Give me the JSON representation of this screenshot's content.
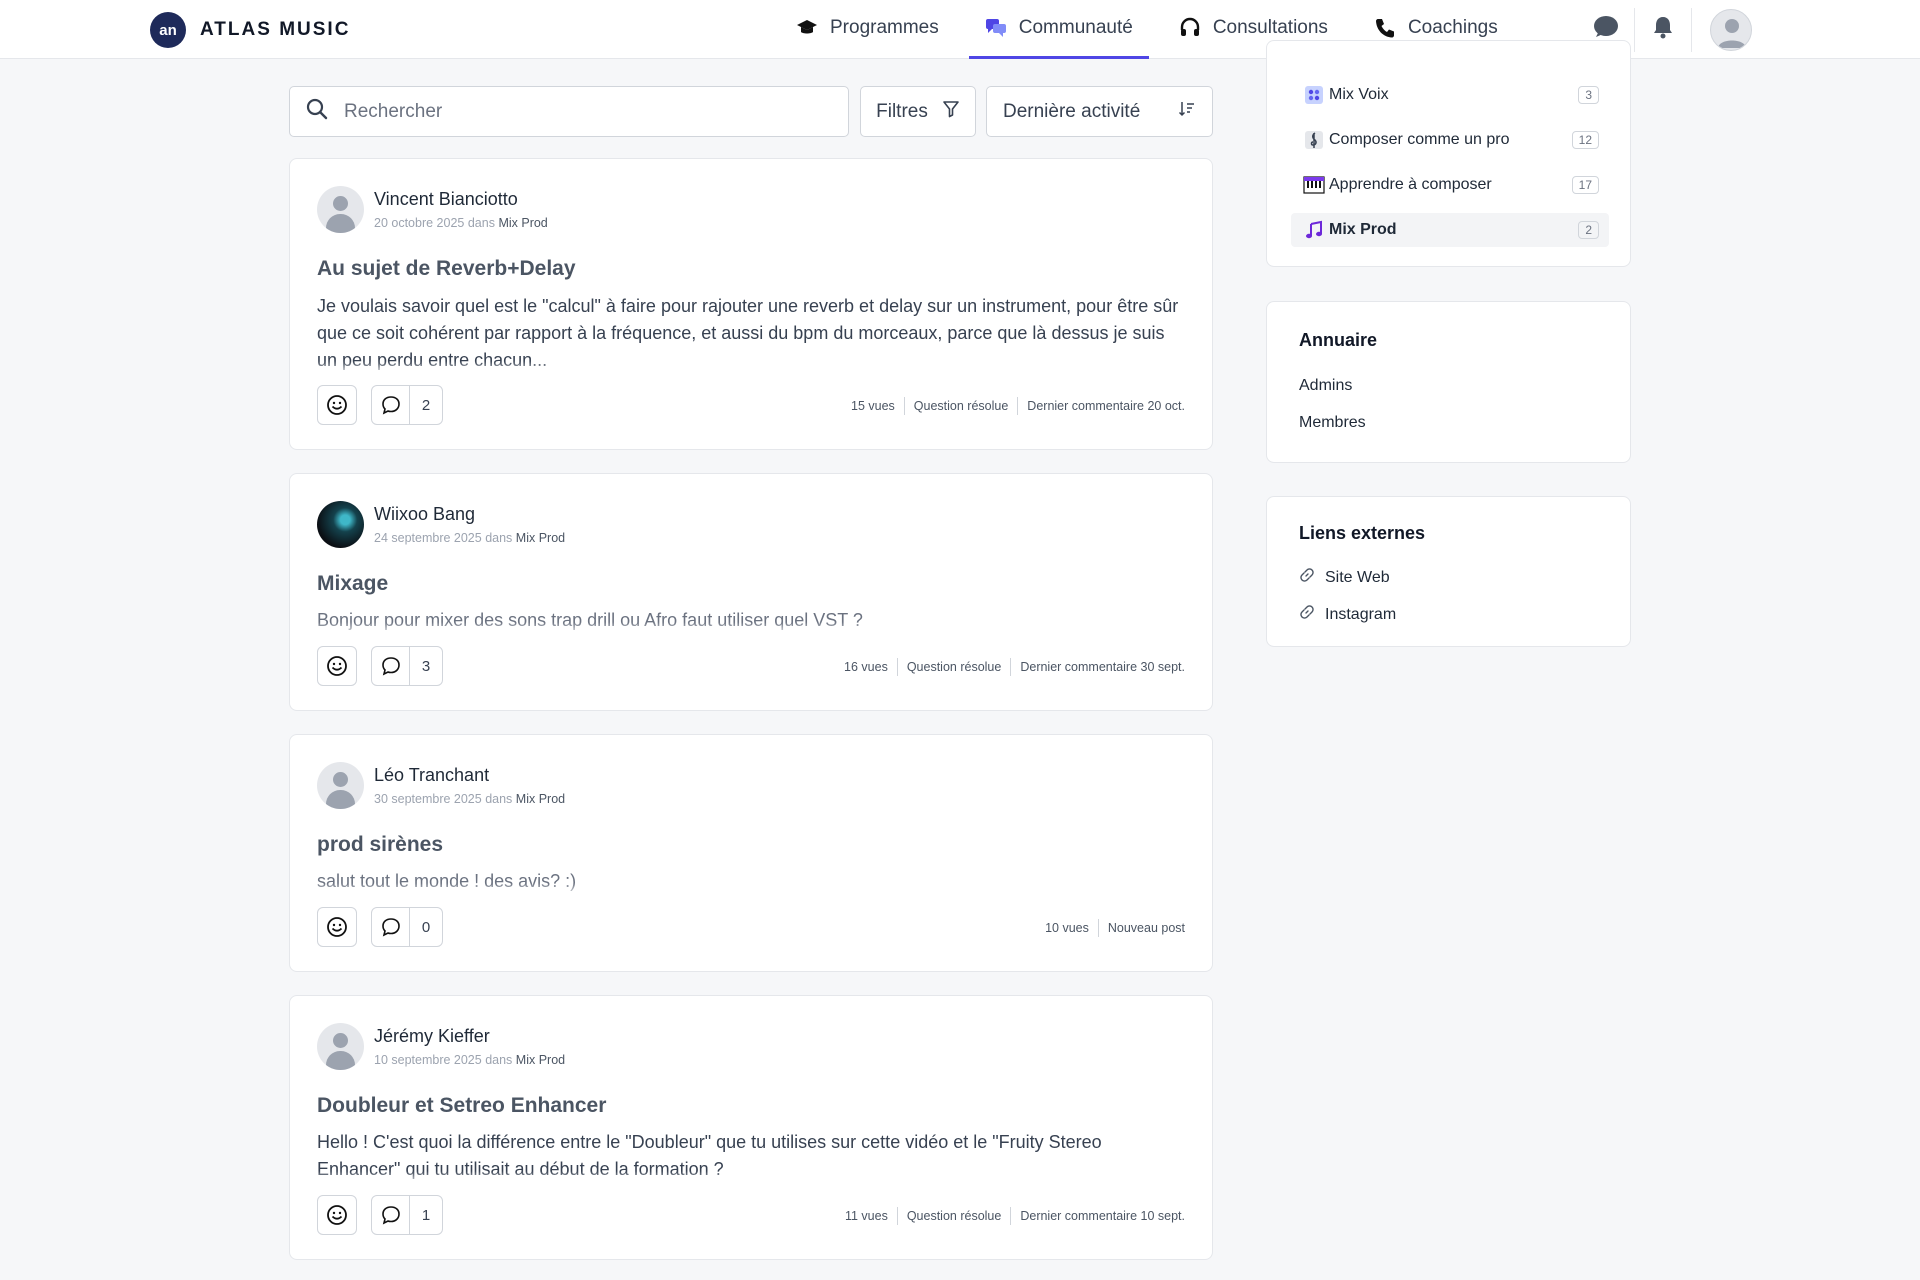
{
  "brand": {
    "logo_mark": "an",
    "name": "ATLAS MUSIC"
  },
  "nav": [
    {
      "label": "Programmes",
      "icon": "graduation-cap-icon"
    },
    {
      "label": "Communauté",
      "icon": "chat-bubbles-icon",
      "active": true
    },
    {
      "label": "Consultations",
      "icon": "headset-icon"
    },
    {
      "label": "Coachings",
      "icon": "phone-icon"
    }
  ],
  "toolbar": {
    "search_placeholder": "Rechercher",
    "filter_label": "Filtres",
    "sort_label": "Dernière activité"
  },
  "posts": [
    {
      "author": "Vincent Bianciotto",
      "date": "20 octobre 2025",
      "in_word": "dans",
      "category": "Mix Prod",
      "title": "Au sujet de Reverb+Delay",
      "body": "Je voulais savoir quel est le \"calcul\" à faire pour rajouter une reverb et delay sur un instrument, pour être sûr que ce soit cohérent par rapport à la fréquence, et aussi du bpm du morceaux, parce que là dessus je suis un peu perdu entre chacun...",
      "comments": "2",
      "views": "15 vues",
      "status": "Question résolue",
      "last_comment": "Dernier commentaire 20 oct."
    },
    {
      "author": "Wiixoo Bang",
      "date": "24 septembre 2025",
      "in_word": "dans",
      "category": "Mix Prod",
      "title": "Mixage",
      "body": "Bonjour pour mixer des sons trap drill ou Afro faut utiliser quel VST ?",
      "comments": "3",
      "views": "16 vues",
      "status": "Question résolue",
      "last_comment": "Dernier commentaire 30 sept."
    },
    {
      "author": "Léo Tranchant",
      "date": "30 septembre 2025",
      "in_word": "dans",
      "category": "Mix Prod",
      "title": "prod sirènes",
      "body": "salut tout le monde ! des avis? :)",
      "comments": "0",
      "views": "10 vues",
      "status": "Nouveau post"
    },
    {
      "author": "Jérémy Kieffer",
      "date": "10 septembre 2025",
      "in_word": "dans",
      "category": "Mix Prod",
      "title": "Doubleur et Setreo Enhancer",
      "body": "Hello ! C'est quoi la différence entre le \"Doubleur\" que tu utilises sur cette vidéo et le \"Fruity Stereo Enhancer\" qui tu utilisait au début de la formation ?",
      "comments": "1",
      "views": "11 vues",
      "status": "Question résolue",
      "last_comment": "Dernier commentaire 10 sept."
    }
  ],
  "categories": [
    {
      "label": "Mix Voix",
      "count": "3",
      "icon": "mixer-icon"
    },
    {
      "label": "Composer comme un pro",
      "count": "12",
      "icon": "treble-clef-icon"
    },
    {
      "label": "Apprendre à composer",
      "count": "17",
      "icon": "piano-keys-icon"
    },
    {
      "label": "Mix Prod",
      "count": "2",
      "icon": "music-notes-icon",
      "active": true
    }
  ],
  "directory": {
    "title": "Annuaire",
    "items": [
      "Admins",
      "Membres"
    ]
  },
  "external_links": {
    "title": "Liens externes",
    "items": [
      "Site Web",
      "Instagram"
    ]
  },
  "colors": {
    "accent": "#4f46e5",
    "brand": "#1e2a5a"
  }
}
